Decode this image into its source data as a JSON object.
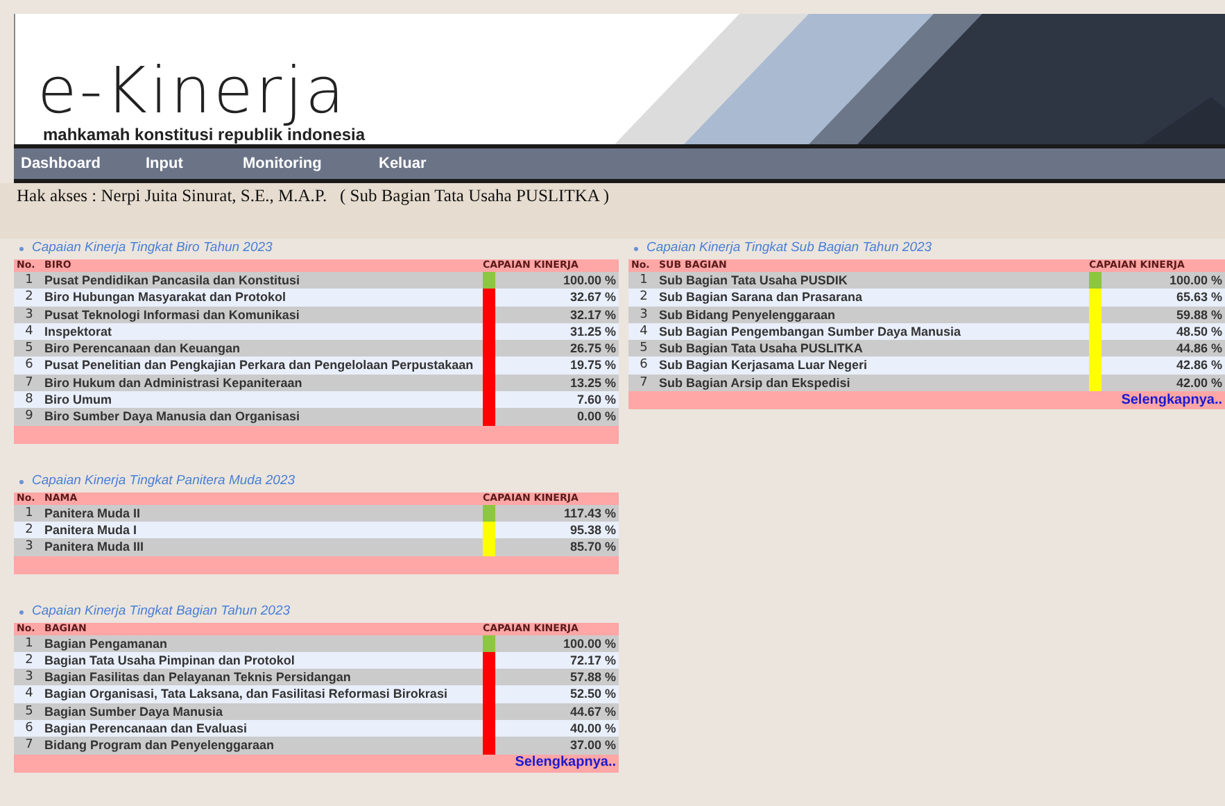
{
  "header": {
    "logo": "e-Kinerja",
    "subtitle": "mahkamah konstitusi republik indonesia"
  },
  "nav": [
    {
      "label": "Dashboard"
    },
    {
      "label": "Input"
    },
    {
      "label": "Monitoring"
    },
    {
      "label": "Keluar"
    }
  ],
  "access": "Hak akses : Nerpi Juita Sinurat, S.E., M.A.P.   ( Sub Bagian Tata Usaha PUSLITKA )",
  "columns": [
    {
      "panels": [
        {
          "title": "Capaian Kinerja Tingkat Biro Tahun 2023",
          "columns": [
            "No.",
            "BIRO",
            "CAPAIAN KINERJA"
          ],
          "rows": [
            {
              "no": "1",
              "name": "Pusat Pendidikan Pancasila dan Konstitusi",
              "value": "100.00 %",
              "color": "#8dc63f"
            },
            {
              "no": "2",
              "name": "Biro Hubungan Masyarakat dan Protokol",
              "value": "32.67 %",
              "color": "#ff0000"
            },
            {
              "no": "3",
              "name": "Pusat Teknologi Informasi dan Komunikasi",
              "value": "32.17 %",
              "color": "#ff0000"
            },
            {
              "no": "4",
              "name": "Inspektorat",
              "value": "31.25 %",
              "color": "#ff0000"
            },
            {
              "no": "5",
              "name": "Biro Perencanaan dan Keuangan",
              "value": "26.75 %",
              "color": "#ff0000"
            },
            {
              "no": "6",
              "name": "Pusat Penelitian dan Pengkajian Perkara dan Pengelolaan Perpustakaan",
              "value": "19.75 %",
              "color": "#ff0000"
            },
            {
              "no": "7",
              "name": "Biro Hukum dan Administrasi Kepaniteraan",
              "value": "13.25 %",
              "color": "#ff0000"
            },
            {
              "no": "8",
              "name": "Biro Umum",
              "value": "7.60 %",
              "color": "#ff0000"
            },
            {
              "no": "9",
              "name": "Biro Sumber Daya Manusia dan Organisasi",
              "value": "0.00 %",
              "color": "#ff0000"
            }
          ]
        },
        {
          "title": "Capaian Kinerja Tingkat Panitera Muda 2023",
          "columns": [
            "No.",
            "NAMA",
            "CAPAIAN KINERJA"
          ],
          "rows": [
            {
              "no": "1",
              "name": "Panitera Muda II",
              "value": "117.43 %",
              "color": "#8dc63f"
            },
            {
              "no": "2",
              "name": "Panitera Muda I",
              "value": "95.38 %",
              "color": "#ffff00"
            },
            {
              "no": "3",
              "name": "Panitera Muda III",
              "value": "85.70 %",
              "color": "#ffff00"
            }
          ]
        },
        {
          "title": "Capaian Kinerja Tingkat Bagian Tahun 2023",
          "columns": [
            "No.",
            "BAGIAN",
            "CAPAIAN KINERJA"
          ],
          "rows": [
            {
              "no": "1",
              "name": "Bagian Pengamanan",
              "value": "100.00 %",
              "color": "#8dc63f"
            },
            {
              "no": "2",
              "name": "Bagian Tata Usaha Pimpinan dan Protokol",
              "value": "72.17 %",
              "color": "#ff0000"
            },
            {
              "no": "3",
              "name": "Bagian Fasilitas dan Pelayanan Teknis Persidangan",
              "value": "57.88 %",
              "color": "#ff0000"
            },
            {
              "no": "4",
              "name": "Bagian Organisasi, Tata Laksana, dan Fasilitasi Reformasi Birokrasi",
              "value": "52.50 %",
              "color": "#ff0000"
            },
            {
              "no": "5",
              "name": "Bagian Sumber Daya Manusia",
              "value": "44.67 %",
              "color": "#ff0000"
            },
            {
              "no": "6",
              "name": "Bagian Perencanaan dan Evaluasi",
              "value": "40.00 %",
              "color": "#ff0000"
            },
            {
              "no": "7",
              "name": "Bidang Program dan Penyelenggaraan",
              "value": "37.00 %",
              "color": "#ff0000"
            }
          ],
          "more_link": "Selengkapnya.."
        }
      ]
    },
    {
      "panels": [
        {
          "title": "Capaian Kinerja Tingkat Sub Bagian Tahun 2023",
          "columns": [
            "No.",
            "SUB BAGIAN",
            "CAPAIAN KINERJA"
          ],
          "rows": [
            {
              "no": "1",
              "name": "Sub Bagian Tata Usaha PUSDIK",
              "value": "100.00 %",
              "color": "#8dc63f"
            },
            {
              "no": "2",
              "name": "Sub Bagian Sarana dan Prasarana",
              "value": "65.63 %",
              "color": "#ffff00"
            },
            {
              "no": "3",
              "name": "Sub Bidang Penyelenggaraan",
              "value": "59.88 %",
              "color": "#ffff00"
            },
            {
              "no": "4",
              "name": "Sub Bagian Pengembangan Sumber Daya Manusia",
              "value": "48.50 %",
              "color": "#ffff00"
            },
            {
              "no": "5",
              "name": "Sub Bagian Tata Usaha PUSLITKA",
              "value": "44.86 %",
              "color": "#ffff00"
            },
            {
              "no": "6",
              "name": "Sub Bagian Kerjasama Luar Negeri",
              "value": "42.86 %",
              "color": "#ffff00"
            },
            {
              "no": "7",
              "name": "Sub Bagian Arsip dan Ekspedisi",
              "value": "42.00 %",
              "color": "#ffff00"
            }
          ],
          "more_link": "Selengkapnya.."
        }
      ]
    }
  ]
}
